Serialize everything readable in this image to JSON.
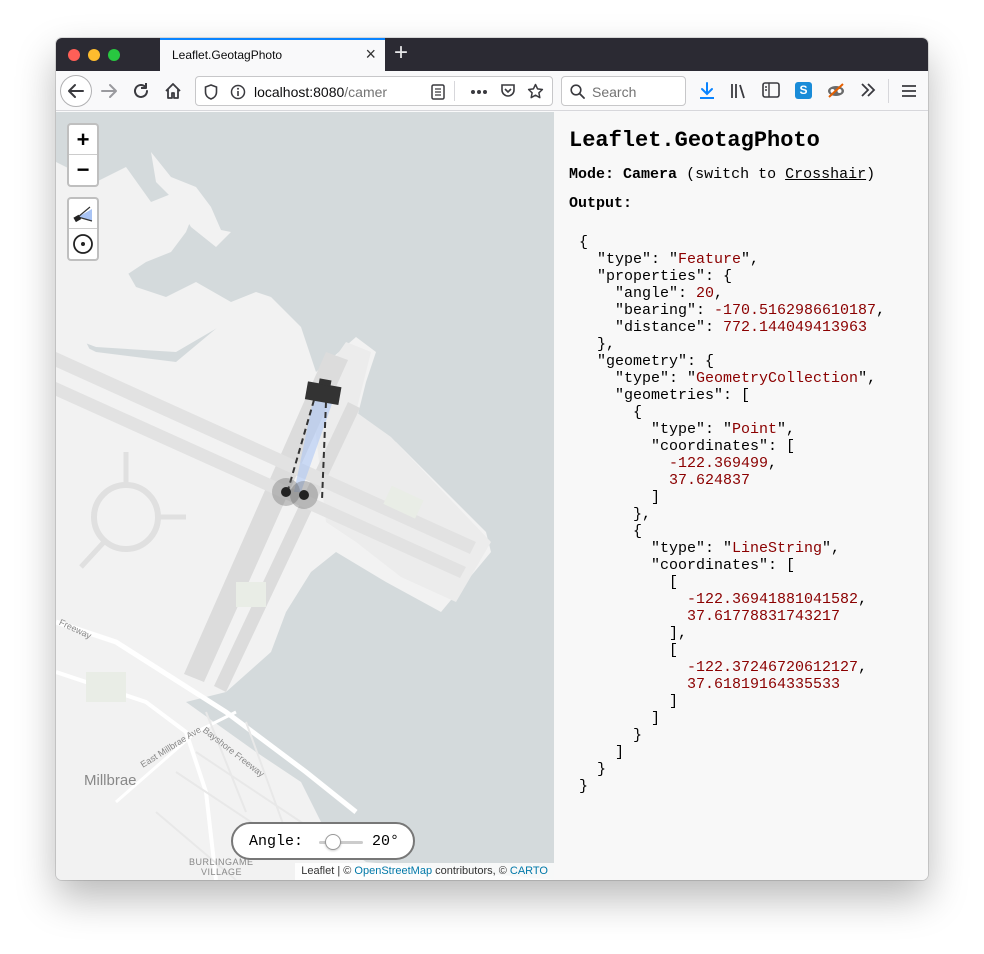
{
  "browser": {
    "tab_title": "Leaflet.GeotagPhoto",
    "url_host": "localhost:8080",
    "url_rest": "/camer",
    "search_placeholder": "Search"
  },
  "panel": {
    "title": "Leaflet.GeotagPhoto",
    "mode_label": "Mode:",
    "mode_value": "Camera",
    "switch_prefix": "(switch to",
    "switch_link": "Crosshair",
    "switch_suffix": ")",
    "output_label": "Output:"
  },
  "output": {
    "type": "Feature",
    "angle": "20",
    "bearing": "-170.5162986610187",
    "distance": "772.144049413963",
    "geometry_type": "GeometryCollection",
    "point_type": "Point",
    "point_lon": "-122.369499",
    "point_lat": "37.624837",
    "line_type": "LineString",
    "line_lon1": "-122.36941881041582",
    "line_lat1": "37.61778831743217",
    "line_lon2": "-122.37246720612127",
    "line_lat2": "37.61819164335533"
  },
  "map": {
    "zoom_in": "+",
    "zoom_out": "−",
    "angle_label": "Angle:",
    "angle_value": "20°",
    "angle": 20,
    "place_millbrae": "Millbrae",
    "place_burlingame_1": "BURLINGAME",
    "place_burlingame_2": "VILLAGE",
    "road_east_millbrae": "East Millbrae Ave",
    "road_bayshore": "Bayshore Freeway",
    "road_freeway": "Freeway",
    "attribution_leaflet": "Leaflet",
    "attribution_mid": " | © ",
    "attribution_osm": "OpenStreetMap",
    "attribution_contrib": " contributors, © ",
    "attribution_carto": "CARTO",
    "colors": {
      "water": "#d4dadc",
      "land": "#f2f2f2",
      "runway": "#dcdcdc",
      "fov": "#a9c4f5"
    }
  }
}
